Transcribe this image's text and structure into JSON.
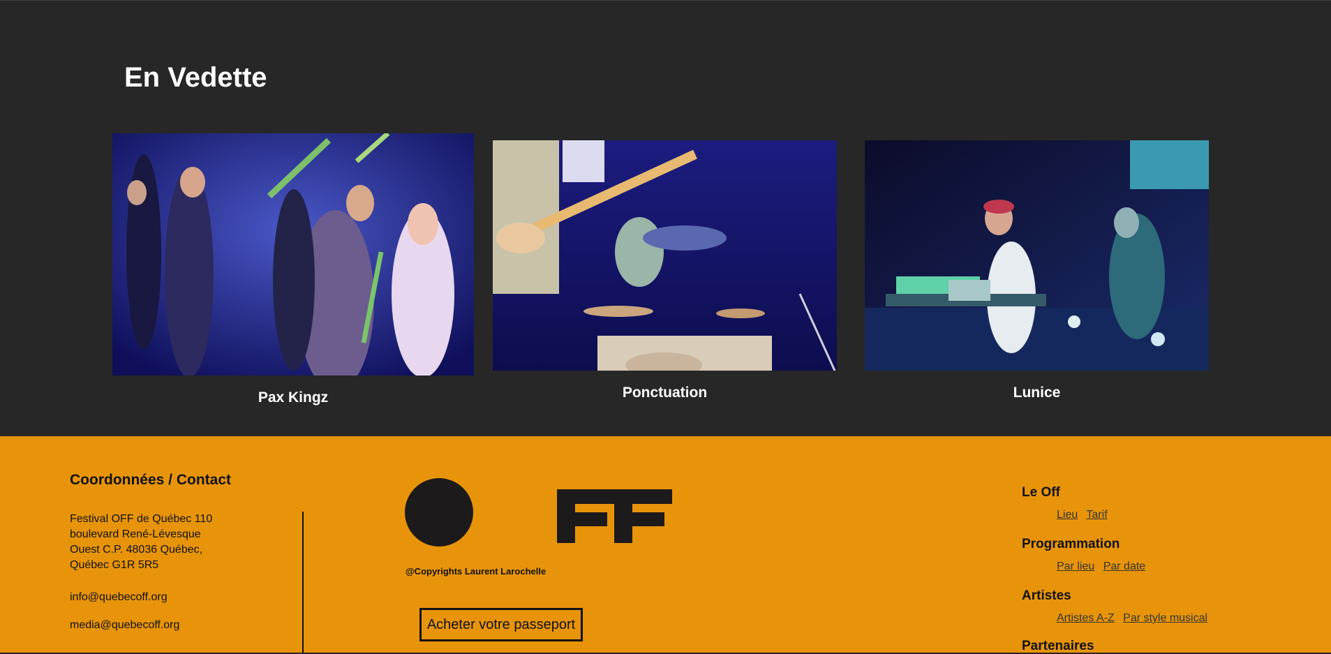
{
  "featured": {
    "title": "En Vedette",
    "artists": [
      {
        "name": "Pax Kingz",
        "photo_alt": "photo-crowd-at-concert"
      },
      {
        "name": "Ponctuation",
        "photo_alt": "photo-band-guitar-drums"
      },
      {
        "name": "Lunice",
        "photo_alt": "photo-dj-performance"
      }
    ]
  },
  "footer": {
    "contact": {
      "title": "Coordonnées / Contact",
      "address": "Festival OFF de Québec 110 boulevard René-Lévesque Ouest C.P. 48036 Québec, Québec G1R 5R5",
      "email_info": "info@quebecoff.org",
      "email_media": "media@quebecoff.org"
    },
    "logo_text": "OFF",
    "copyright": "@Copyrights Laurent Larochelle",
    "pass_button": "Acheter votre passeport",
    "nav": [
      {
        "heading": "Le Off",
        "links": [
          "Lieu",
          "Tarif"
        ]
      },
      {
        "heading": "Programmation",
        "links": [
          "Par lieu",
          "Par date"
        ]
      },
      {
        "heading": "Artistes",
        "links": [
          "Artistes A-Z",
          "Par style musical"
        ]
      },
      {
        "heading": "Partenaires",
        "links": []
      }
    ]
  },
  "colors": {
    "dark_bg": "#272727",
    "footer_bg": "#E8940A",
    "photo_blue": "#1a1a6e"
  }
}
